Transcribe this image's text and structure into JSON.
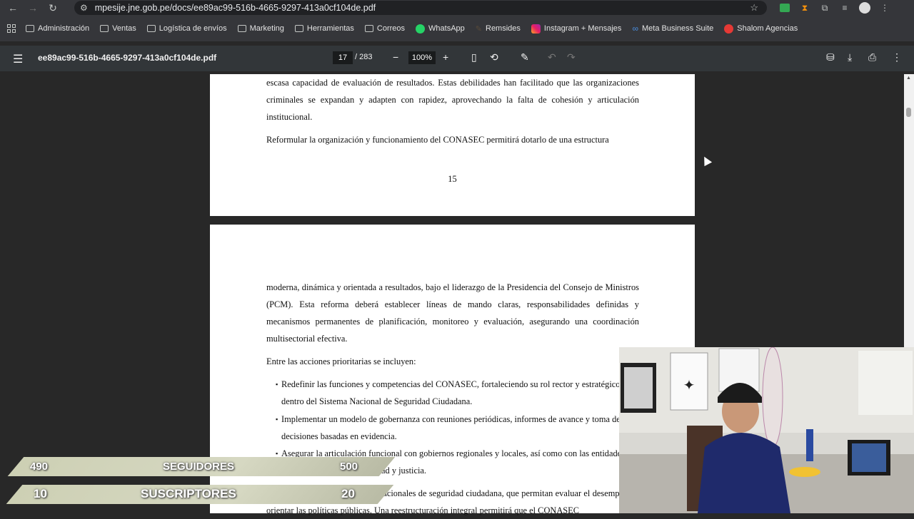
{
  "browser": {
    "url": "mpesije.jne.gob.pe/docs/ee89ac99-516b-4665-9297-413a0cf104de.pdf",
    "bookmarks": [
      {
        "label": "Administración",
        "icon": "folder-icon"
      },
      {
        "label": "Ventas",
        "icon": "folder-icon"
      },
      {
        "label": "Logística de envíos",
        "icon": "folder-icon"
      },
      {
        "label": "Marketing",
        "icon": "folder-icon"
      },
      {
        "label": "Herramientas",
        "icon": "folder-icon"
      },
      {
        "label": "Correos",
        "icon": "folder-icon"
      },
      {
        "label": "WhatsApp",
        "icon": "whatsapp-icon"
      },
      {
        "label": "Remsides",
        "icon": "remsides-icon"
      },
      {
        "label": "Instagram + Mensajes",
        "icon": "instagram-icon"
      },
      {
        "label": "Meta Business Suite",
        "icon": "meta-icon"
      },
      {
        "label": "Shalom Agencias",
        "icon": "shalom-icon"
      }
    ]
  },
  "pdf_viewer": {
    "filename": "ee89ac99-516b-4665-9297-413a0cf104de.pdf",
    "current_page": "17",
    "total_pages": "/ 283",
    "zoom": "100%"
  },
  "document": {
    "page1": {
      "p1": "escasa capacidad de evaluación de resultados. Estas debilidades han facilitado que las organizaciones criminales se expandan y adapten con rapidez, aprovechando la falta de cohesión y articulación institucional.",
      "p2": "Reformular la organización y funcionamiento del CONASEC permitirá dotarlo de una estructura",
      "page_number": "15"
    },
    "page2": {
      "p1": "moderna, dinámica y orientada a resultados, bajo el liderazgo de la Presidencia del Consejo de Ministros (PCM). Esta reforma deberá establecer líneas de mando claras, responsabilidades definidas y mecanismos permanentes de planificación, monitoreo y evaluación, asegurando una coordinación multisectorial efectiva.",
      "p2": "Entre las acciones prioritarias se incluyen:",
      "bullets": [
        "Redefinir las funciones y competencias del CONASEC, fortaleciendo su rol rector y estratégico dentro del Sistema Nacional de Seguridad Ciudadana.",
        "Implementar un modelo de gobernanza con reuniones periódicas, informes de avance y toma de decisiones basadas en evidencia.",
        "Asegurar la articulación funcional con gobiernos regionales y locales, así como con las entidades ejecutivas del sector seguridad y justicia."
      ],
      "p3": "Establecer indicadores y metas nacionales de seguridad ciudadana, que permitan evaluar el desempeño y orientar las políticas públicas. Una reestructuración integral permitirá que el CONASEC"
    }
  },
  "stream_overlay": {
    "followers": {
      "current": "490",
      "label": "SEGUIDORES",
      "goal": "500"
    },
    "subscribers": {
      "current": "10",
      "label": "SUSCRIPTORES",
      "goal": "20"
    }
  },
  "colors": {
    "chrome_bg": "#35363a",
    "pdf_toolbar": "#323639",
    "viewer_bg": "#282828",
    "overlay_bar": "#cdd0b4"
  }
}
